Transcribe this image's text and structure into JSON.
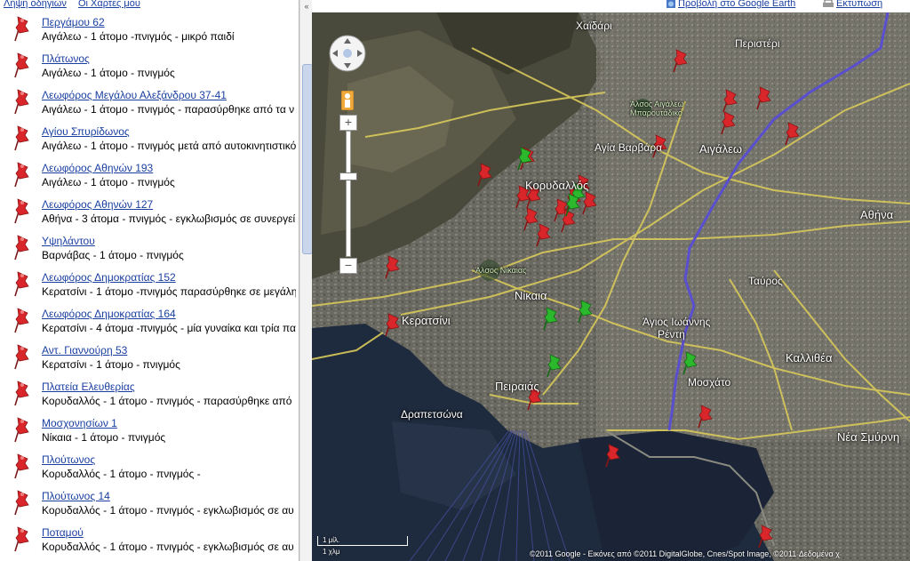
{
  "sidebar": {
    "top_links": [
      "Λήψη οδηγιών",
      "Οι Χάρτες μου"
    ],
    "collapse_label": "«",
    "items": [
      {
        "title": "Περγάμου 62",
        "desc": "Αιγάλεω - 1 άτομο -πνιγμός - μικρό παιδί"
      },
      {
        "title": "Πλάτωνος",
        "desc": "Αιγάλεω - 1 άτομο - πνιγμός"
      },
      {
        "title": "Λεωφόρος Μεγάλου Αλεξάνδρου 37-41",
        "desc": "Αιγάλεω - 1 άτομο - πνιγμός - παρασύρθηκε από τα ν"
      },
      {
        "title": "Αγίου Σπυρίδωνος",
        "desc": "Αιγάλεω - 1 άτομο - πνιγμός μετά από αυτοκινητιστικό"
      },
      {
        "title": "Λεωφόρος Αθηνών 193",
        "desc": "Αιγάλεω - 1 άτομο - πνιγμός"
      },
      {
        "title": "Λεωφόρος Αθηνών 127",
        "desc": "Αθήνα - 3 άτομα - πνιγμός - εγκλωβισμός σε συνεργεί"
      },
      {
        "title": "Υψηλάντου",
        "desc": "Βαρνάβας - 1 άτομο - πνιγμός"
      },
      {
        "title": "Λεωφόρος Δημοκρατίας 152",
        "desc": "Κερατσίνι - 1 άτομο -πνιγμός παρασύρθηκε σε μεγάλη"
      },
      {
        "title": "Λεωφόρος Δημοκρατίας 164",
        "desc": "Κερατσίνι - 4 άτομα -πνιγμός - μία γυναίκα και τρία πα"
      },
      {
        "title": "Αντ. Γιαννούρη 53",
        "desc": "Κερατσίνι - 1 άτομο - πνιγμός"
      },
      {
        "title": "Πλατεία Ελευθερίας",
        "desc": "Κορυδαλλός - 1 άτομο - πνιγμός - παρασύρθηκε από"
      },
      {
        "title": "Μοσχονησίων 1",
        "desc": "Νίκαια - 1 άτομο - πνιγμός"
      },
      {
        "title": "Πλούτωνος",
        "desc": "Κορυδαλλός - 1 άτομο - πνιγμός -"
      },
      {
        "title": "Πλούτωνος 14",
        "desc": "Κορυδαλλός - 1 άτομο - πνιγμός - εγκλωβισμός σε αυ"
      },
      {
        "title": "Ποταμού",
        "desc": "Κορυδαλλός - 1 άτομο - πνιγμός - εγκλωβισμός σε αυ"
      }
    ]
  },
  "topbar": {
    "google_earth": "Προβολή στο Google Earth",
    "print": "Εκτύπωση"
  },
  "map": {
    "labels": {
      "chaidari": "Χαϊδάρι",
      "peristeri": "Περιστέρι",
      "alsos": "Άλσος Αιγάλεω",
      "alsos2": "Μπαρουτάδικο",
      "agia_varvara": "Αγία Βαρβάρα",
      "aigaleo": "Αιγάλεω",
      "korydallos": "Κορυδαλλός",
      "athina": "Αθήνα",
      "alsos_nikaias": "Άλσος Νίκαιας",
      "nikaia": "Νίκαια",
      "tavros": "Ταύρος",
      "keratsini": "Κερατσίνι",
      "agios_ioannis": "Άγιος Ιωάννης",
      "rentis": "Ρέντη",
      "kallithea": "Καλλιθέα",
      "peiraias": "Πειραιάς",
      "moschato": "Μοσχάτο",
      "drapetsona": "Δραπετσώνα",
      "nea_smyrni": "Νέα Σμύρνη"
    },
    "scale_mi": "1 μίλ.",
    "scale_km": "1 χλμ",
    "copyright": "©2011 Google - Εικόνες από ©2011 DigitalGlobe, Cnes/Spot Image, ©2011 Δεδομένα χ",
    "colors": {
      "red_pin": "#d9262b",
      "green_pin": "#2cb82c",
      "road": "#d8c95a",
      "metro": "#5a4fcf"
    }
  }
}
